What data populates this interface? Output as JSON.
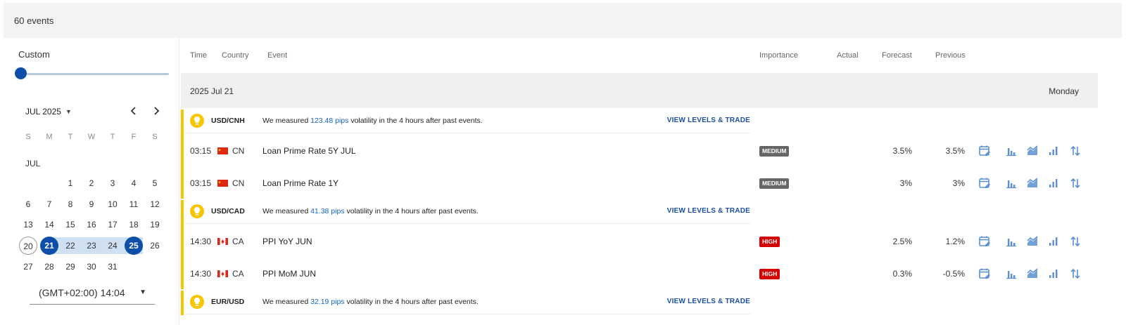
{
  "header": {
    "event_count": "60 events"
  },
  "filters": {
    "range_label": "Custom",
    "calendar": {
      "month_label": "JUL 2025",
      "month_tag": "JUL",
      "weekdays": [
        "S",
        "M",
        "T",
        "W",
        "T",
        "F",
        "S"
      ],
      "days": [
        "1",
        "2",
        "3",
        "4",
        "5",
        "6",
        "7",
        "8",
        "9",
        "10",
        "11",
        "12",
        "13",
        "14",
        "15",
        "16",
        "17",
        "18",
        "19",
        "20",
        "21",
        "22",
        "23",
        "24",
        "25",
        "26",
        "27",
        "28",
        "29",
        "30",
        "31"
      ],
      "today": "20",
      "range_start": "21",
      "range_end": "25"
    },
    "timezone": "(GMT+02:00) 14:04"
  },
  "table": {
    "columns": {
      "time": "Time",
      "country": "Country",
      "event": "Event",
      "importance": "Importance",
      "actual": "Actual",
      "forecast": "Forecast",
      "previous": "Previous"
    },
    "date_header": {
      "date": "2025 Jul 21",
      "weekday": "Monday"
    },
    "volatility_prefix": "We measured",
    "volatility_suffix": "volatility in the 4 hours after past events.",
    "cta_label": "VIEW LEVELS & TRADE",
    "groups": [
      {
        "pair": "USD/CNH",
        "pips": "123.48 pips",
        "events": [
          {
            "time": "03:15",
            "country": "CN",
            "name": "Loan Prime Rate 5Y JUL",
            "importance": "MEDIUM",
            "actual": "",
            "forecast": "3.5%",
            "previous": "3.5%"
          },
          {
            "time": "03:15",
            "country": "CN",
            "name": "Loan Prime Rate 1Y",
            "importance": "MEDIUM",
            "actual": "",
            "forecast": "3%",
            "previous": "3%"
          }
        ]
      },
      {
        "pair": "USD/CAD",
        "pips": "41.38 pips",
        "events": [
          {
            "time": "14:30",
            "country": "CA",
            "name": "PPI YoY JUN",
            "importance": "HIGH",
            "actual": "",
            "forecast": "2.5%",
            "previous": "1.2%"
          },
          {
            "time": "14:30",
            "country": "CA",
            "name": "PPI MoM JUN",
            "importance": "HIGH",
            "actual": "",
            "forecast": "0.3%",
            "previous": "-0.5%"
          }
        ]
      },
      {
        "pair": "EUR/USD",
        "pips": "32.19 pips",
        "events": []
      }
    ],
    "row_action_icons": [
      "calendar-edit-icon",
      "bar-chart-icon",
      "area-chart-icon",
      "signal-bars-icon",
      "sort-arrows-icon"
    ]
  },
  "colors": {
    "accent": "#0d4fa8",
    "range_fill": "#cfe0f3",
    "volatility_bar": "#f7c600",
    "pips_link": "#1565c0",
    "high_badge": "#d40000",
    "medium_badge": "#666666",
    "action_icon": "#5b8fd0"
  }
}
